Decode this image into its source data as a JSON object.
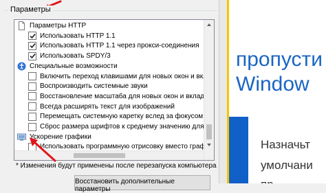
{
  "dialog": {
    "group_title": "Параметры",
    "items": [
      {
        "kind": "category",
        "icon": "file-icon",
        "label": "Параметры HTTP"
      },
      {
        "kind": "option",
        "checked": true,
        "label": "Использовать HTTP 1.1"
      },
      {
        "kind": "option",
        "checked": true,
        "label": "Использовать HTTP 1.1 через прокси-соединения"
      },
      {
        "kind": "option",
        "checked": true,
        "label": "Использовать SPDY/3"
      },
      {
        "kind": "category",
        "icon": "accessibility-icon",
        "label": "Специальные возможности"
      },
      {
        "kind": "option",
        "checked": false,
        "label": "Включить переход клавишами для новых окон и вклад"
      },
      {
        "kind": "option",
        "checked": false,
        "label": "Воспроизводить системные звуки"
      },
      {
        "kind": "option",
        "checked": false,
        "label": "Восстановление масштаба для новых окон и вкладок"
      },
      {
        "kind": "option",
        "checked": false,
        "label": "Всегда расширять текст для изображений"
      },
      {
        "kind": "option",
        "checked": false,
        "label": "Перемещать системную каретку вслед за фокусом и"
      },
      {
        "kind": "option",
        "checked": false,
        "label": "Сброс размера шрифтов к среднему значению для н"
      },
      {
        "kind": "category",
        "icon": "graphics-icon",
        "label": "Ускорение графики"
      },
      {
        "kind": "option",
        "checked": false,
        "label": "Использовать программную отрисовку вместо графич"
      }
    ],
    "note": "* Изменения будут применены после перезапуска компьютера",
    "restore_button": "Восстановить дополнительные параметры"
  },
  "background": {
    "line1": "пропусти",
    "line2": "Window",
    "line3": "Назначьт",
    "line4": "умолчани",
    "line5": "пр...."
  },
  "colors": {
    "annotation_arrow": "#e0161b",
    "checkmark": "#1a1a1a",
    "accent_yellow": "#f5c400",
    "win_blue": "#1a65c4",
    "tile_blue": "#1060c7"
  }
}
